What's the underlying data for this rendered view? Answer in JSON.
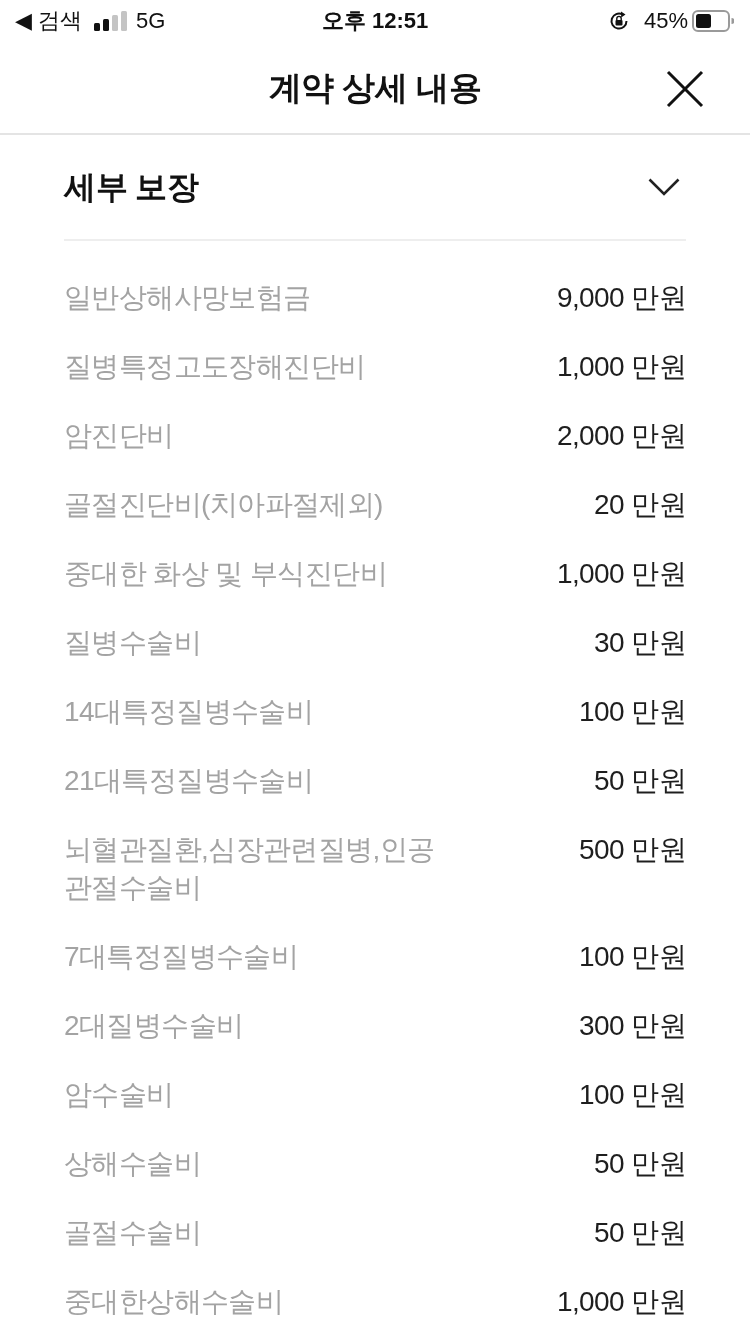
{
  "status_bar": {
    "back_label": "◀ 검색",
    "network": "5G",
    "time": "오후 12:51",
    "battery": "45%"
  },
  "header": {
    "title": "계약 상세 내용"
  },
  "section": {
    "title": "세부 보장",
    "expanded": true,
    "rows": [
      {
        "label": "일반상해사망보험금",
        "value": "9,000 만원"
      },
      {
        "label": "질병특정고도장해진단비",
        "value": "1,000 만원"
      },
      {
        "label": "암진단비",
        "value": "2,000 만원"
      },
      {
        "label": "골절진단비(치아파절제외)",
        "value": "20 만원"
      },
      {
        "label": "중대한 화상 및 부식진단비",
        "value": "1,000 만원"
      },
      {
        "label": "질병수술비",
        "value": "30 만원"
      },
      {
        "label": "14대특정질병수술비",
        "value": "100 만원"
      },
      {
        "label": "21대특정질병수술비",
        "value": "50 만원"
      },
      {
        "label": "뇌혈관질환,심장관련질병,인공관절수술비",
        "value": "500 만원"
      },
      {
        "label": "7대특정질병수술비",
        "value": "100 만원"
      },
      {
        "label": "2대질병수술비",
        "value": "300 만원"
      },
      {
        "label": "암수술비",
        "value": "100 만원"
      },
      {
        "label": "상해수술비",
        "value": "50 만원"
      },
      {
        "label": "골절수술비",
        "value": "50 만원"
      },
      {
        "label": "중대한상해수술비",
        "value": "1,000 만원"
      }
    ]
  }
}
